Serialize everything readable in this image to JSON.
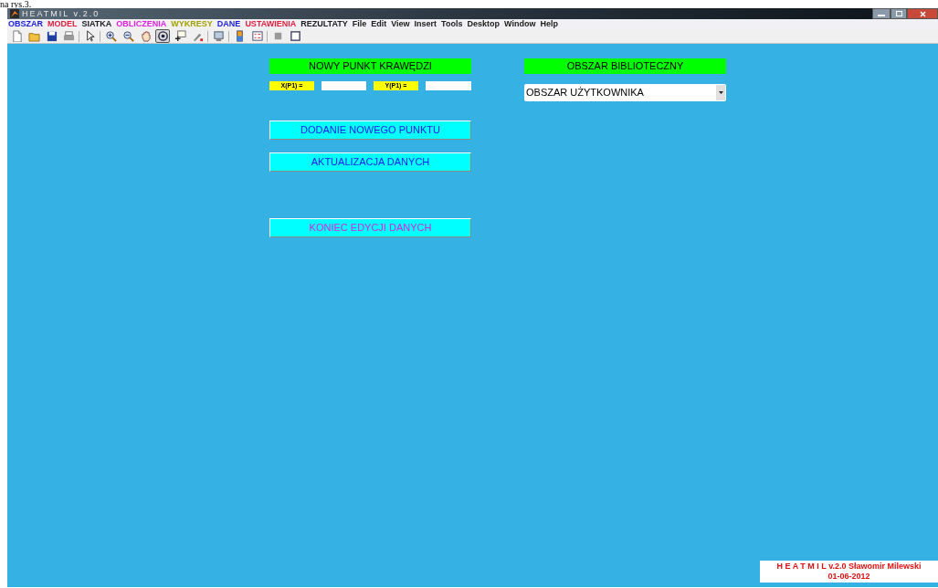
{
  "page_caption": "na rys.3.",
  "window": {
    "title": "HEATMIL  v.2.0"
  },
  "menu": [
    {
      "label": "OBSZAR",
      "color": "#1c1cd8"
    },
    {
      "label": "MODEL",
      "color": "#e01c3c"
    },
    {
      "label": "SIATKA",
      "color": "#202020"
    },
    {
      "label": "OBLICZENIA",
      "color": "#e020e0"
    },
    {
      "label": "WYKRESY",
      "color": "#a0a000"
    },
    {
      "label": "DANE",
      "color": "#1c1cd8"
    },
    {
      "label": "USTAWIENIA",
      "color": "#e01c3c"
    },
    {
      "label": "REZULTATY",
      "color": "#202020"
    },
    {
      "label": "File",
      "color": "#202020"
    },
    {
      "label": "Edit",
      "color": "#202020"
    },
    {
      "label": "View",
      "color": "#202020"
    },
    {
      "label": "Insert",
      "color": "#202020"
    },
    {
      "label": "Tools",
      "color": "#202020"
    },
    {
      "label": "Desktop",
      "color": "#202020"
    },
    {
      "label": "Window",
      "color": "#202020"
    },
    {
      "label": "Help",
      "color": "#202020"
    }
  ],
  "toolbar": [
    {
      "kind": "new",
      "selected": false
    },
    {
      "kind": "open",
      "selected": false
    },
    {
      "kind": "save",
      "selected": false
    },
    {
      "kind": "print",
      "selected": false
    },
    {
      "kind": "sep"
    },
    {
      "kind": "pointer",
      "selected": false
    },
    {
      "kind": "sep"
    },
    {
      "kind": "zoomin",
      "selected": false
    },
    {
      "kind": "zoomout",
      "selected": false
    },
    {
      "kind": "pan",
      "selected": false
    },
    {
      "kind": "rotate",
      "selected": true
    },
    {
      "kind": "datacursor",
      "selected": false
    },
    {
      "kind": "brush",
      "selected": false
    },
    {
      "kind": "sep"
    },
    {
      "kind": "link",
      "selected": false
    },
    {
      "kind": "sep"
    },
    {
      "kind": "colorbar",
      "selected": false
    },
    {
      "kind": "legend",
      "selected": false
    },
    {
      "kind": "sep"
    },
    {
      "kind": "hide",
      "selected": false
    },
    {
      "kind": "show",
      "selected": false
    }
  ],
  "edge_point": {
    "header": "NOWY PUNKT KRAWĘDZI",
    "x_label": "X(P1) =",
    "y_label": "Y(P1) ="
  },
  "buttons": [
    {
      "label": "DODANIE NOWEGO PUNKTU",
      "kind": "action"
    },
    {
      "label": "AKTUALIZACJA DANYCH",
      "kind": "action"
    },
    {
      "label": "KONIEC EDYCJI DANYCH",
      "kind": "finish"
    }
  ],
  "library": {
    "header": "OBSZAR BIBLIOTECZNY",
    "dropdown_value": "OBSZAR UŻYTKOWNIKA"
  },
  "footer": {
    "line_1": "H E A T M I L v.2.0    Sławomir Milewski",
    "line_2": "01-06-2012"
  }
}
